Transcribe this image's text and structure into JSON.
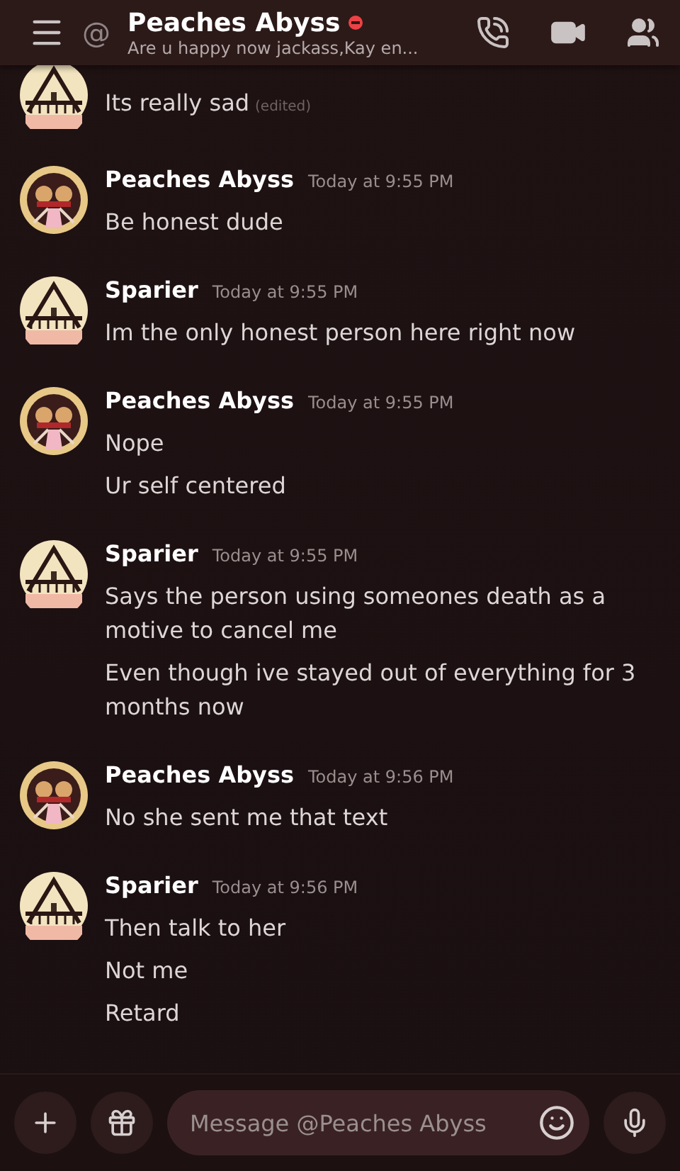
{
  "header": {
    "at_sign": "@",
    "title": "Peaches Abyss",
    "status": {
      "kind": "dnd"
    },
    "subtitle": "Are u happy now jackass,Kay en..."
  },
  "groups": [
    {
      "avatar": {
        "kind": "sparier"
      },
      "messages": [
        {
          "text": "Its really sad",
          "edited": "(edited)"
        }
      ]
    },
    {
      "avatar": {
        "kind": "peaches"
      },
      "author": "Peaches Abyss",
      "time": "Today at 9:55 PM",
      "messages": [
        {
          "text": "Be honest dude"
        }
      ]
    },
    {
      "avatar": {
        "kind": "sparier"
      },
      "author": "Sparier",
      "time": "Today at 9:55 PM",
      "messages": [
        {
          "text": "Im the only honest person here right now"
        }
      ]
    },
    {
      "avatar": {
        "kind": "peaches"
      },
      "author": "Peaches Abyss",
      "time": "Today at 9:55 PM",
      "messages": [
        {
          "text": "Nope"
        },
        {
          "text": "Ur self centered"
        }
      ]
    },
    {
      "avatar": {
        "kind": "sparier"
      },
      "author": "Sparier",
      "time": "Today at 9:55 PM",
      "messages": [
        {
          "text": "Says the person using someones death as a motive to cancel me"
        },
        {
          "text": "Even though ive stayed out of everything for 3 months now"
        }
      ]
    },
    {
      "avatar": {
        "kind": "peaches"
      },
      "author": "Peaches Abyss",
      "time": "Today at 9:56 PM",
      "messages": [
        {
          "text": "No she sent me that text"
        }
      ]
    },
    {
      "avatar": {
        "kind": "sparier"
      },
      "author": "Sparier",
      "time": "Today at 9:56 PM",
      "messages": [
        {
          "text": "Then talk to her"
        },
        {
          "text": "Not me"
        },
        {
          "text": "Retard"
        }
      ]
    }
  ],
  "composer": {
    "placeholder": "Message @Peaches Abyss"
  }
}
